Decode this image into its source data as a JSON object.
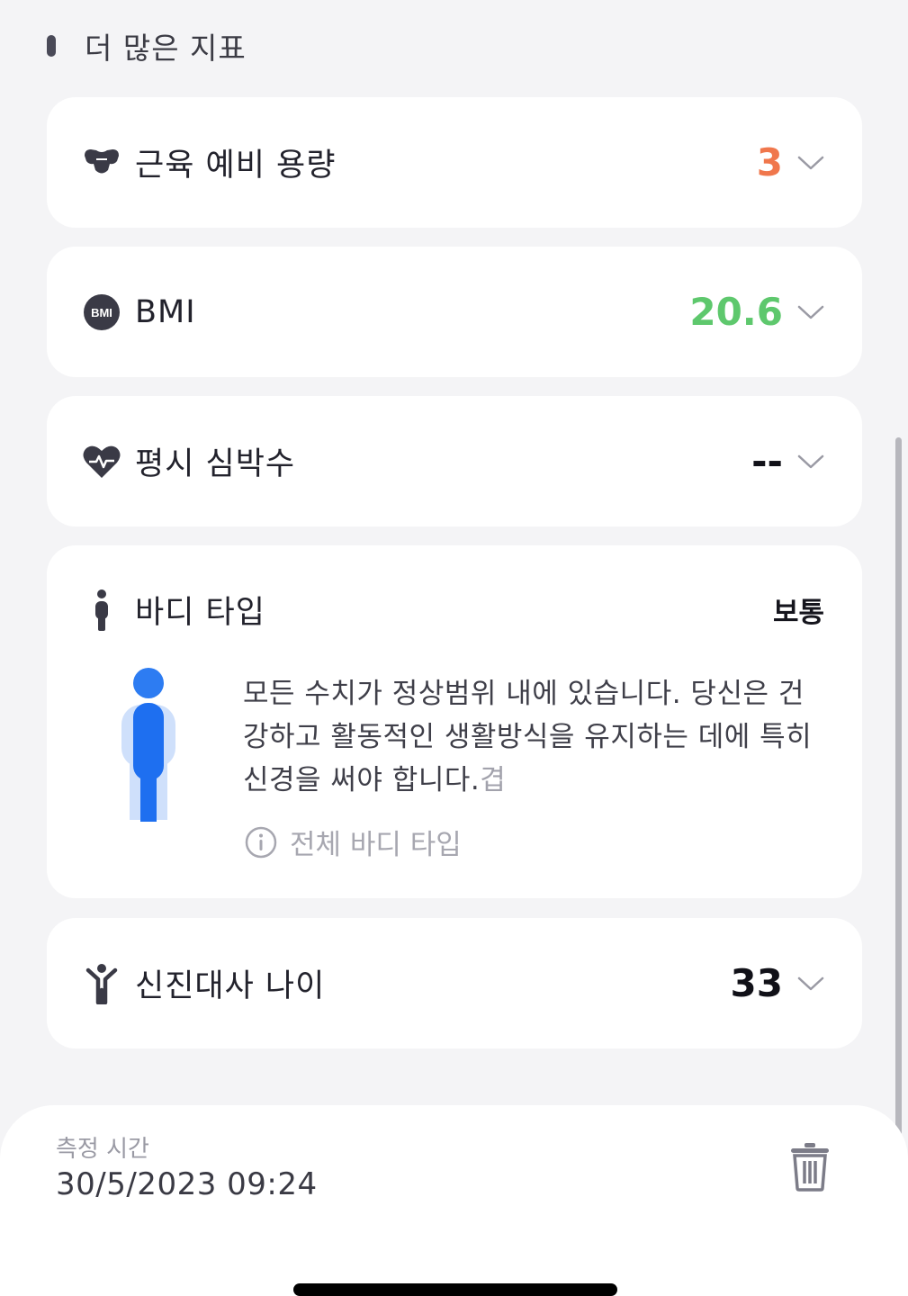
{
  "section": {
    "title": "더 많은 지표"
  },
  "metrics": [
    {
      "icon": "muscle-icon",
      "label": "근육 예비 용량",
      "value": "3",
      "value_color": "#f0774c"
    },
    {
      "icon": "bmi-icon",
      "label": "BMI",
      "value": "20.6",
      "value_color": "#5ec86d"
    },
    {
      "icon": "heart-rate-icon",
      "label": "평시 심박수",
      "value": "--",
      "value_color": "#111118"
    }
  ],
  "body_type": {
    "icon": "body-figure-icon",
    "label": "바디 타입",
    "status": "보통",
    "description": "모든 수치가 정상범위 내에 있습니다. 당신은 건강하고 활동적인 생활방식을 유지하는 데에 특히 신경을 써야 합니다.",
    "more": "겹",
    "all_types_link": "전체 바디 타입"
  },
  "metabolic_age": {
    "icon": "person-arms-up-icon",
    "label": "신진대사 나이",
    "value": "33",
    "value_color": "#111118"
  },
  "measurement": {
    "label": "측정 시간",
    "time": "30/5/2023 09:24"
  },
  "colors": {
    "accent_blue": "#1e6ff0",
    "background": "#f4f4f6"
  }
}
